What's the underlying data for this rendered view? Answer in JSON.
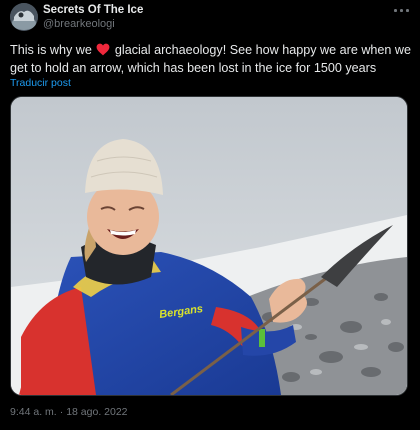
{
  "author": {
    "display_name": "Secrets Of The Ice",
    "handle": "@brearkeologi"
  },
  "tweet": {
    "text_before_heart": "This is why we",
    "heart_icon": "red-heart-emoji",
    "text_after_heart": "glacial archaeology! See how happy we are when we get to hold an arrow, which has been lost in the ice for 1500 years",
    "translate_label": "Traducir post",
    "time": "9:44 a. m.",
    "separator": "·",
    "date": "18 ago. 2022"
  },
  "media": {
    "jacket_brand_text": "Bergans"
  },
  "colors": {
    "background": "#000000",
    "text_primary": "#e7e9ea",
    "text_secondary": "#71767b",
    "link": "#1d9bf0",
    "heart": "#f91880"
  }
}
